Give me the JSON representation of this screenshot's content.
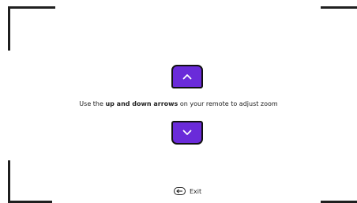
{
  "instruction": {
    "prefix": "Use the ",
    "emphasis": "up and down arrows",
    "suffix": " on your remote to adjust zoom"
  },
  "controls": {
    "up_icon": "chevron-up-icon",
    "down_icon": "chevron-down-icon",
    "button_color": "#6a2bd9"
  },
  "exit": {
    "label": "Exit",
    "icon": "back-arrow-icon"
  }
}
